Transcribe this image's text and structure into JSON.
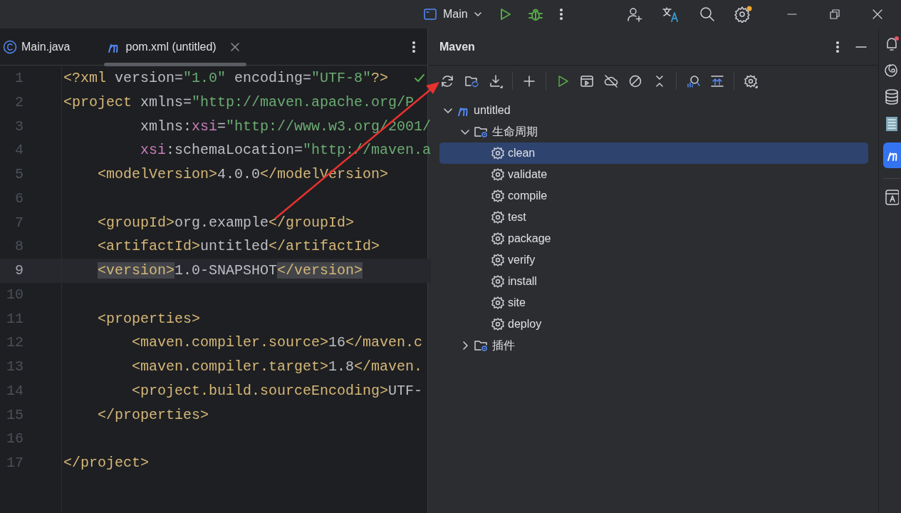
{
  "run_config": {
    "label": "Main"
  },
  "editor_tabs": [
    {
      "label": "Main.java",
      "kind": "java",
      "selected": false
    },
    {
      "label": "pom.xml (untitled)",
      "kind": "maven",
      "selected": true
    }
  ],
  "code_lines": [
    {
      "number": "1",
      "current": false,
      "tokens": [
        {
          "kind": "tag",
          "text": "<?xml "
        },
        {
          "kind": "attr",
          "text": "version="
        },
        {
          "kind": "str",
          "text": "\"1.0\" "
        },
        {
          "kind": "attr",
          "text": "encoding="
        },
        {
          "kind": "str",
          "text": "\"UTF-8\""
        },
        {
          "kind": "tag",
          "text": "?>"
        }
      ]
    },
    {
      "number": "2",
      "current": false,
      "tokens": [
        {
          "kind": "tag",
          "text": "<project "
        },
        {
          "kind": "attr",
          "text": "xmlns="
        },
        {
          "kind": "str",
          "text": "\"http://maven.apache.org/P"
        }
      ]
    },
    {
      "number": "3",
      "current": false,
      "tokens": [
        {
          "kind": "attr",
          "text": "         xmlns:"
        },
        {
          "kind": "ns",
          "text": "xsi"
        },
        {
          "kind": "attr",
          "text": "="
        },
        {
          "kind": "str",
          "text": "\"http://www.w3.org/2001/"
        }
      ]
    },
    {
      "number": "4",
      "current": false,
      "tokens": [
        {
          "kind": "ns",
          "text": "         xsi"
        },
        {
          "kind": "attr",
          "text": ":schemaLocation="
        },
        {
          "kind": "str",
          "text": "\"http://maven.a"
        }
      ]
    },
    {
      "number": "5",
      "current": false,
      "tokens": [
        {
          "kind": "tag",
          "text": "    <modelVersion>"
        },
        {
          "kind": "text",
          "text": "4.0.0"
        },
        {
          "kind": "tag",
          "text": "</modelVersion>"
        }
      ]
    },
    {
      "number": "6",
      "current": false
    },
    {
      "number": "7",
      "current": false,
      "tokens": [
        {
          "kind": "tag",
          "text": "    <groupId>"
        },
        {
          "kind": "text",
          "text": "org.example"
        },
        {
          "kind": "tag",
          "text": "</groupId>"
        }
      ]
    },
    {
      "number": "8",
      "current": false,
      "tokens": [
        {
          "kind": "tag",
          "text": "    <artifactId>"
        },
        {
          "kind": "text",
          "text": "untitled"
        },
        {
          "kind": "tag",
          "text": "</artifactId>"
        }
      ]
    },
    {
      "number": "9",
      "current": true,
      "tokens": [
        {
          "kind": "tag",
          "text": "    <version>"
        },
        {
          "kind": "text",
          "text": "1.0-SNAPSHOT"
        },
        {
          "kind": "tag",
          "text": "</version>"
        }
      ]
    },
    {
      "number": "10",
      "current": false
    },
    {
      "number": "11",
      "current": false,
      "tokens": [
        {
          "kind": "tag",
          "text": "    <properties>"
        }
      ]
    },
    {
      "number": "12",
      "current": false,
      "tokens": [
        {
          "kind": "tag",
          "text": "        <maven.compiler.source>"
        },
        {
          "kind": "text",
          "text": "16"
        },
        {
          "kind": "tag",
          "text": "</maven.c"
        }
      ]
    },
    {
      "number": "13",
      "current": false,
      "tokens": [
        {
          "kind": "tag",
          "text": "        <maven.compiler.target>"
        },
        {
          "kind": "text",
          "text": "1.8"
        },
        {
          "kind": "tag",
          "text": "</maven."
        }
      ]
    },
    {
      "number": "14",
      "current": false,
      "tokens": [
        {
          "kind": "tag",
          "text": "        <project.build.sourceEncoding>"
        },
        {
          "kind": "text",
          "text": "UTF-"
        }
      ]
    },
    {
      "number": "15",
      "current": false,
      "tokens": [
        {
          "kind": "tag",
          "text": "    </properties>"
        }
      ]
    },
    {
      "number": "16",
      "current": false
    },
    {
      "number": "17",
      "current": false,
      "tokens": [
        {
          "kind": "tag",
          "text": "</project>"
        }
      ]
    }
  ],
  "maven_panel": {
    "title": "Maven",
    "tree": [
      {
        "label": "untitled",
        "kind": "module",
        "selected": false,
        "expanded": true,
        "children": [
          {
            "label": "生命周期",
            "kind": "folder",
            "selected": false,
            "expanded": true,
            "children": [
              {
                "label": "clean",
                "kind": "goal",
                "selected": true
              },
              {
                "label": "validate",
                "kind": "goal",
                "selected": false
              },
              {
                "label": "compile",
                "kind": "goal",
                "selected": false
              },
              {
                "label": "test",
                "kind": "goal",
                "selected": false
              },
              {
                "label": "package",
                "kind": "goal",
                "selected": false
              },
              {
                "label": "verify",
                "kind": "goal",
                "selected": false
              },
              {
                "label": "install",
                "kind": "goal",
                "selected": false
              },
              {
                "label": "site",
                "kind": "goal",
                "selected": false
              },
              {
                "label": "deploy",
                "kind": "goal",
                "selected": false
              }
            ]
          },
          {
            "label": "插件",
            "kind": "folder",
            "selected": false,
            "expanded": false
          }
        ]
      }
    ]
  }
}
